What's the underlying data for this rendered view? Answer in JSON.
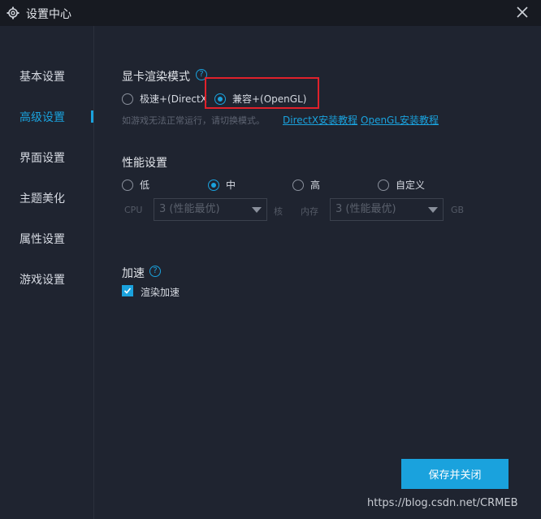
{
  "window": {
    "title": "设置中心",
    "icons": {
      "settings": "gear-icon",
      "close": "close-icon"
    }
  },
  "sidebar": {
    "items": [
      {
        "label": "基本设置",
        "active": false
      },
      {
        "label": "高级设置",
        "active": true
      },
      {
        "label": "界面设置",
        "active": false
      },
      {
        "label": "主题美化",
        "active": false
      },
      {
        "label": "属性设置",
        "active": false
      },
      {
        "label": "游戏设置",
        "active": false
      }
    ]
  },
  "render_mode": {
    "title": "显卡渲染模式",
    "options": [
      {
        "label": "极速+(DirectX",
        "checked": false
      },
      {
        "label": "兼容+(OpenGL)",
        "checked": true
      }
    ],
    "hint": "如游戏无法正常运行，请切换模式。",
    "links": [
      "DirectX安装教程",
      "OpenGL安装教程"
    ]
  },
  "performance": {
    "title": "性能设置",
    "options": [
      {
        "label": "低",
        "checked": false
      },
      {
        "label": "中",
        "checked": true
      },
      {
        "label": "高",
        "checked": false
      },
      {
        "label": "自定义",
        "checked": false
      }
    ],
    "cpu_label": "CPU",
    "cpu_value": "3 (性能最优)",
    "cpu_unit": "核",
    "mem_label": "内存",
    "mem_value": "3 (性能最优)",
    "mem_unit": "GB"
  },
  "acceleration": {
    "title": "加速",
    "checkbox_label": "渲染加速",
    "checked": true
  },
  "footer": {
    "save_label": "保存并关闭"
  },
  "watermark": "https://blog.csdn.net/CRMEB",
  "colors": {
    "accent": "#1aa2dd",
    "background": "#1f2430",
    "titlebar": "#171a21",
    "highlight": "#e0212b"
  }
}
